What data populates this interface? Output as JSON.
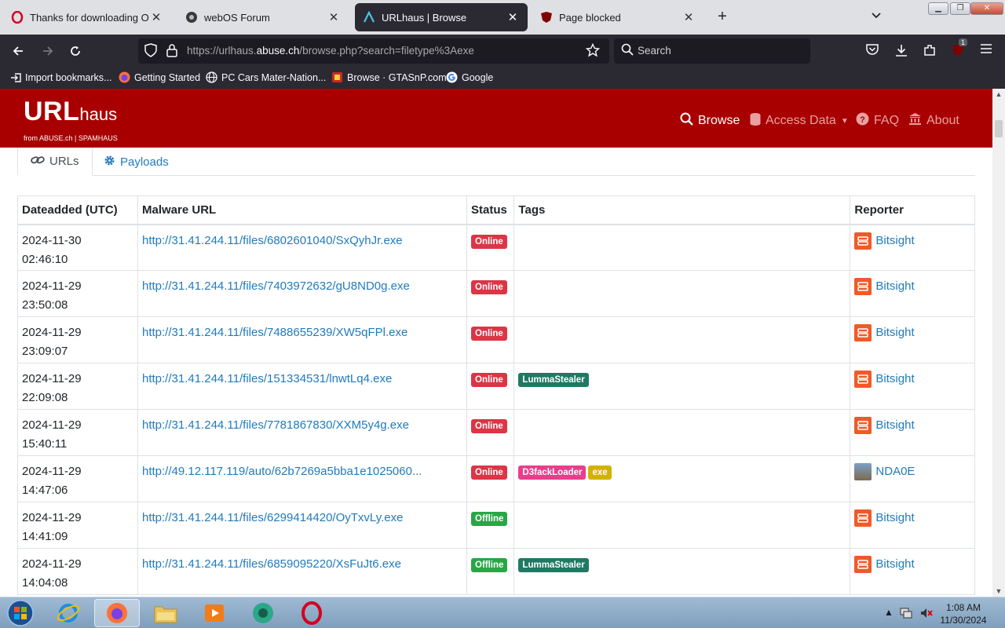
{
  "browser": {
    "tabs": [
      {
        "title": "Thanks for downloading Opera",
        "icon": "opera-icon"
      },
      {
        "title": "webOS Forum",
        "icon": "forum-icon"
      },
      {
        "title": "URLhaus | Browse",
        "icon": "urlhaus-icon",
        "active": true
      },
      {
        "title": "Page blocked",
        "icon": "ublock-icon"
      }
    ],
    "close_glyph": "✕",
    "new_tab_glyph": "+",
    "url_host_prefix": "https://urlhaus.",
    "url_host": "abuse.ch",
    "url_path": "/browse.php?search=filetype%3Aexe",
    "search_placeholder": "Search",
    "ublock_count": "1",
    "bookmarks": [
      {
        "label": "Import bookmarks...",
        "icon": "import-icon"
      },
      {
        "label": "Getting Started",
        "icon": "firefox-icon"
      },
      {
        "label": "PC Cars Mater-Nation...",
        "icon": "globe-icon"
      },
      {
        "label": "Browse · GTASnP.com",
        "icon": "gtasnp-icon"
      },
      {
        "label": "Google",
        "icon": "google-icon"
      }
    ]
  },
  "site": {
    "logo_main": "URL",
    "logo_sub": "haus",
    "logo_tagline": "from ABUSE.ch | SPAMHAUS",
    "menu": [
      {
        "label": "Browse",
        "icon": "search-icon"
      },
      {
        "label": "Access Data",
        "icon": "database-icon"
      },
      {
        "label": "FAQ",
        "icon": "question-icon"
      },
      {
        "label": "About",
        "icon": "building-icon"
      }
    ],
    "tabs": [
      {
        "label": "URLs",
        "icon": "link-icon"
      },
      {
        "label": "Payloads",
        "icon": "gear-icon"
      }
    ],
    "table": {
      "headers": [
        "Dateadded (UTC)",
        "Malware URL",
        "Status",
        "Tags",
        "Reporter"
      ],
      "rows": [
        {
          "date": "2024-11-30",
          "time": "02:46:10",
          "url": "http://31.41.244.11/files/6802601040/SxQyhJr.exe",
          "status": "Online",
          "tags": [],
          "reporter": "Bitsight"
        },
        {
          "date": "2024-11-29",
          "time": "23:50:08",
          "url": "http://31.41.244.11/files/7403972632/gU8ND0g.exe",
          "status": "Online",
          "tags": [],
          "reporter": "Bitsight"
        },
        {
          "date": "2024-11-29",
          "time": "23:09:07",
          "url": "http://31.41.244.11/files/7488655239/XW5qFPl.exe",
          "status": "Online",
          "tags": [],
          "reporter": "Bitsight"
        },
        {
          "date": "2024-11-29",
          "time": "22:09:08",
          "url": "http://31.41.244.11/files/151334531/lnwtLq4.exe",
          "status": "Online",
          "tags": [
            "LummaStealer"
          ],
          "reporter": "Bitsight"
        },
        {
          "date": "2024-11-29",
          "time": "15:40:11",
          "url": "http://31.41.244.11/files/7781867830/XXM5y4g.exe",
          "status": "Online",
          "tags": [],
          "reporter": "Bitsight"
        },
        {
          "date": "2024-11-29",
          "time": "14:47:06",
          "url": "http://49.12.117.119/auto/62b7269a5bba1e1025060...",
          "status": "Online",
          "tags": [
            "D3fackLoader",
            "exe"
          ],
          "reporter": "NDA0E"
        },
        {
          "date": "2024-11-29",
          "time": "14:41:09",
          "url": "http://31.41.244.11/files/6299414420/OyTxvLy.exe",
          "status": "Offline",
          "tags": [],
          "reporter": "Bitsight"
        },
        {
          "date": "2024-11-29",
          "time": "14:04:08",
          "url": "http://31.41.244.11/files/6859095220/XsFuJt6.exe",
          "status": "Offline",
          "tags": [
            "LummaStealer"
          ],
          "reporter": "Bitsight"
        }
      ]
    }
  },
  "colors": {
    "online": "#dc3545",
    "offline": "#28a745",
    "LummaStealer": "#1e7a62",
    "D3fackLoader": "#e83e8c",
    "exe": "#d4b106",
    "Bitsight": "#f05a28"
  },
  "taskbar": {
    "items": [
      "start-orb-icon",
      "internet-explorer-icon",
      "firefox-icon",
      "file-explorer-icon",
      "media-player-icon",
      "chat-app-icon",
      "opera-icon"
    ],
    "time": "1:08 AM",
    "date": "11/30/2024"
  }
}
